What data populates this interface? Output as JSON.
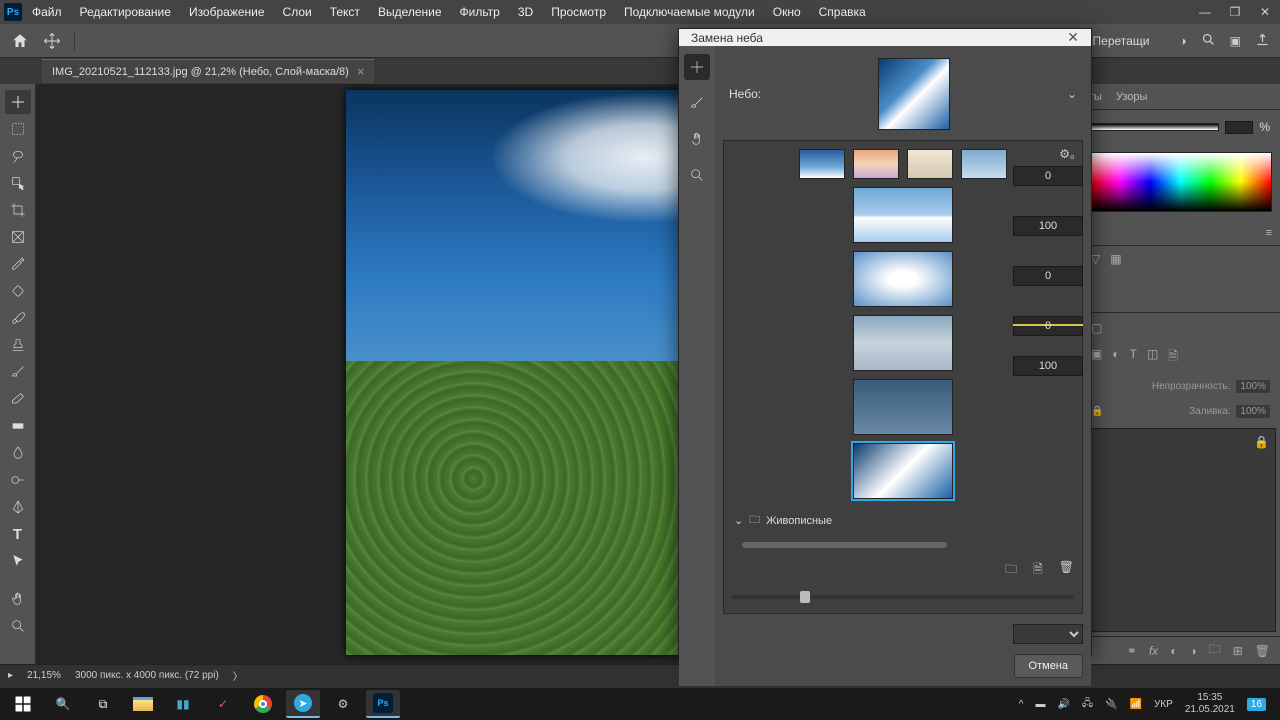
{
  "menubar": {
    "items": [
      "Файл",
      "Редактирование",
      "Изображение",
      "Слои",
      "Текст",
      "Выделение",
      "Фильтр",
      "3D",
      "Просмотр",
      "Подключаемые модули",
      "Окно",
      "Справка"
    ]
  },
  "optbar": {
    "drag_hint": "Перетащи"
  },
  "tab": {
    "title": "IMG_20210521_112133.jpg @ 21,2% (Небо, Слой-маска/8)"
  },
  "dialog": {
    "title": "Замена неба",
    "sky_label": "Небо:",
    "category": "Живописные",
    "sliders": [
      0,
      100,
      0,
      0,
      100
    ],
    "cancel": "Отмена"
  },
  "rightpanels": {
    "tabs": [
      "ты",
      "Узоры"
    ],
    "opacity_pct": "%",
    "opacity_label": "Непрозрачность:",
    "opacity_val": "100%",
    "fill_label": "Заливка:",
    "fill_val": "100%"
  },
  "statusbar": {
    "zoom": "21,15%",
    "docinfo": "3000 пикс. x 4000 пикс. (72 ppi)"
  },
  "taskbar": {
    "lang": "УКР",
    "time": "15:35",
    "date": "21.05.2021",
    "notif": "16"
  }
}
